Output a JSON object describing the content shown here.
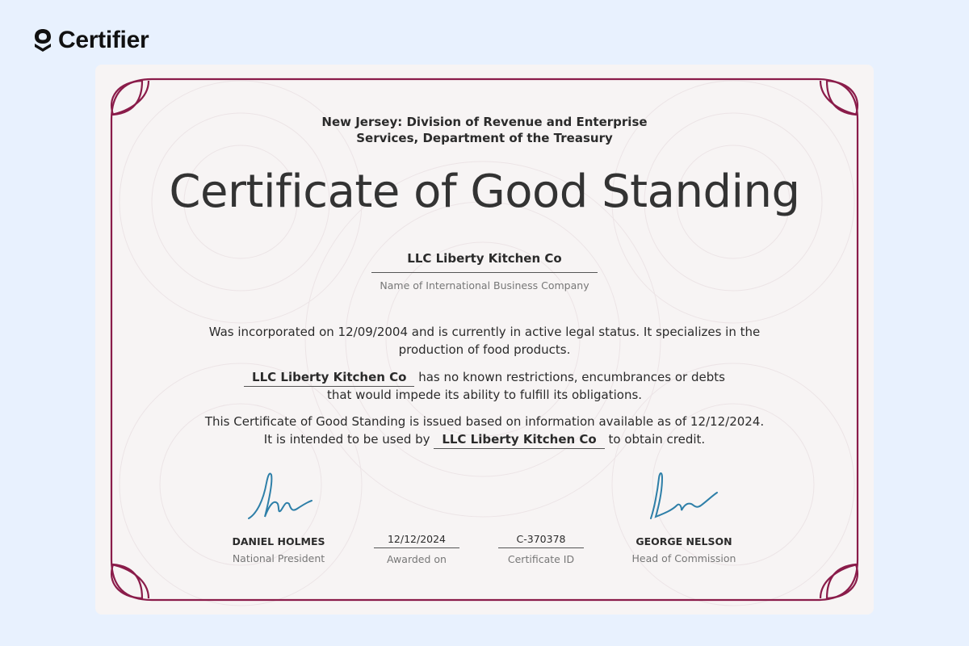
{
  "brand": {
    "name": "Certifier",
    "icon": "certifier-logo-icon"
  },
  "colors": {
    "frame": "#8a1c4a",
    "page_bg": "#e8f1fe",
    "paper_bg": "#f7f4f4"
  },
  "certificate": {
    "issuer_line1": "New Jersey: Division of Revenue and Enterprise",
    "issuer_line2": "Services, Department of the Treasury",
    "title": "Certificate of Good Standing",
    "company_name": "LLC Liberty Kitchen Co",
    "company_caption": "Name of International Business Company",
    "p1_line1": "Was incorporated on 12/09/2004 and is currently in active legal status. It specializes in the",
    "p1_line2": "production of food products.",
    "p2_company": "LLC Liberty Kitchen Co",
    "p2_rest": " has no known restrictions, encumbrances or debts",
    "p2_line2": "that would impede its ability to fulfill its obligations.",
    "p3_line1": "This Certificate of Good Standing is issued based on information available as of 12/12/2024.",
    "p3_pre": "It is intended to be used by ",
    "p3_company": "LLC Liberty Kitchen Co",
    "p3_post": " to obtain credit.",
    "signatory_left": {
      "name": "DANIEL HOLMES",
      "role": "National President"
    },
    "awarded": {
      "value": "12/12/2024",
      "caption": "Awarded on"
    },
    "cert_id": {
      "value": "C-370378",
      "caption": "Certificate ID"
    },
    "signatory_right": {
      "name": "GEORGE NELSON",
      "role": "Head of Commission"
    }
  }
}
